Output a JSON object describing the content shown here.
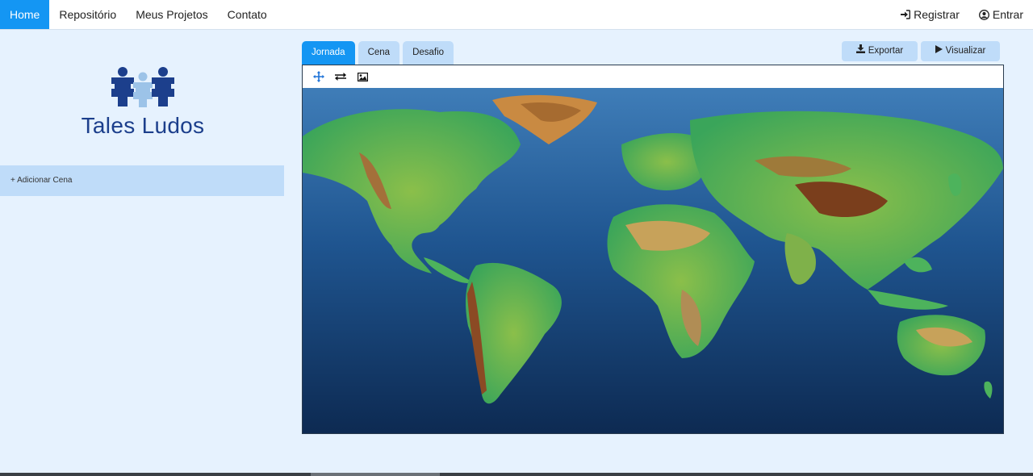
{
  "nav": {
    "items": [
      {
        "label": "Home",
        "active": true
      },
      {
        "label": "Repositório",
        "active": false
      },
      {
        "label": "Meus Projetos",
        "active": false
      },
      {
        "label": "Contato",
        "active": false
      }
    ],
    "register_label": "Registrar",
    "register_icon": "sign-in-icon",
    "login_label": "Entrar",
    "login_icon": "user-circle-icon"
  },
  "sidebar": {
    "logo_text": "Tales Ludos",
    "add_scene_label": "+ Adicionar Cena"
  },
  "tabs": [
    {
      "label": "Jornada",
      "active": true
    },
    {
      "label": "Cena",
      "active": false
    },
    {
      "label": "Desafio",
      "active": false
    }
  ],
  "actions": {
    "export_label": "Exportar",
    "export_icon": "download-icon",
    "view_label": "Visualizar",
    "view_icon": "play-icon"
  },
  "toolbar": {
    "tools": [
      "move-icon",
      "swap-icon",
      "image-icon"
    ]
  },
  "colors": {
    "accent": "#1496f3",
    "tab_inactive": "#bfdcf9",
    "page_bg": "#e6f2fe",
    "logo_dark": "#1c3f8c",
    "logo_light": "#9cc3e8"
  }
}
